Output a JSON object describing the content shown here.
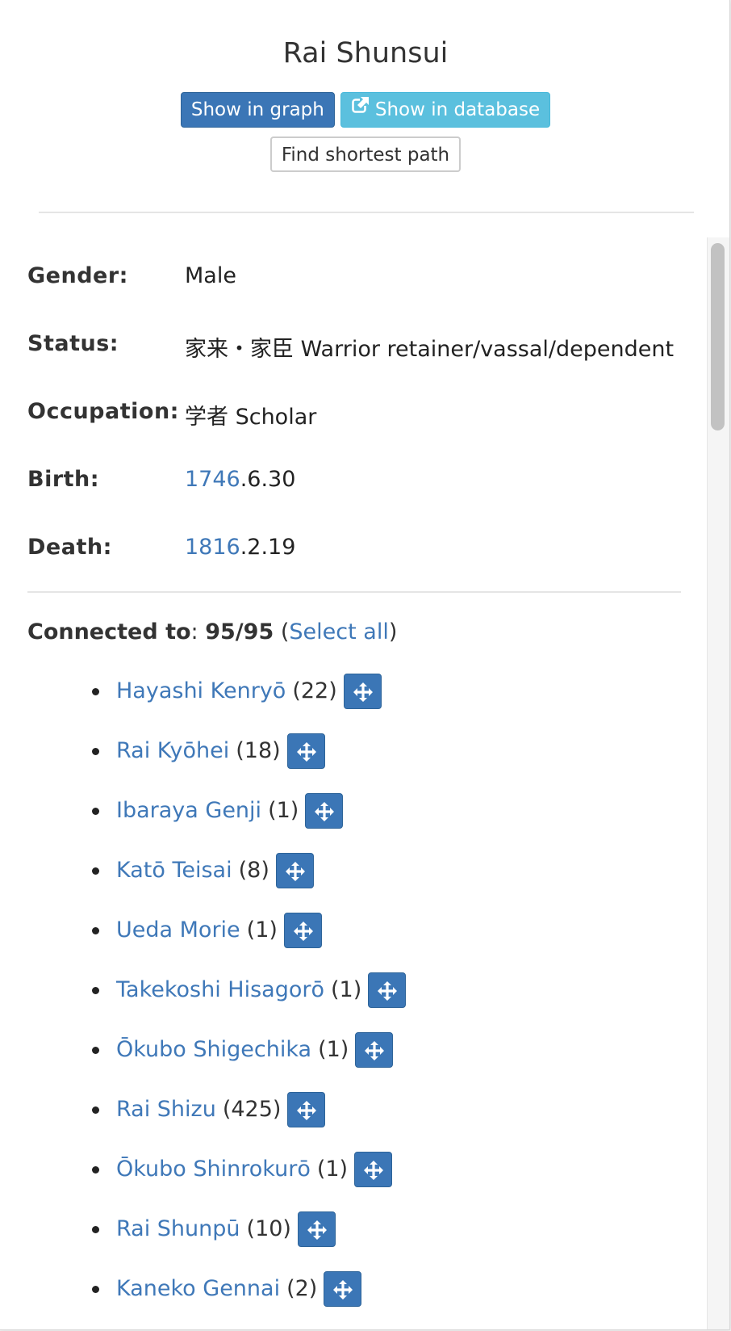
{
  "header": {
    "title": "Rai Shunsui",
    "show_in_graph_label": "Show in graph",
    "show_in_database_label": "Show in database",
    "find_shortest_path_label": "Find shortest path"
  },
  "fields": {
    "gender": {
      "label": "Gender:",
      "value": "Male"
    },
    "status": {
      "label": "Status:",
      "value": "家来・家臣 Warrior retainer/vassal/dependent"
    },
    "occupation": {
      "label": "Occupation:",
      "value": "学者 Scholar"
    },
    "birth": {
      "label": "Birth:",
      "year": "1746",
      "rest": ".6.30"
    },
    "death": {
      "label": "Death:",
      "year": "1816",
      "rest": ".2.19"
    }
  },
  "connections": {
    "label": "Connected to",
    "separator": ":",
    "count": "95/95",
    "select_all_open": "(",
    "select_all_label": "Select all",
    "select_all_close": ")",
    "items": [
      {
        "name": "Hayashi Kenryō",
        "count": "(22)"
      },
      {
        "name": "Rai Kyōhei",
        "count": "(18)"
      },
      {
        "name": "Ibaraya Genji",
        "count": "(1)"
      },
      {
        "name": "Katō Teisai",
        "count": "(8)"
      },
      {
        "name": "Ueda Morie",
        "count": "(1)"
      },
      {
        "name": "Takekoshi Hisagorō",
        "count": "(1)"
      },
      {
        "name": "Ōkubo Shigechika",
        "count": "(1)"
      },
      {
        "name": "Rai Shizu",
        "count": "(425)"
      },
      {
        "name": "Ōkubo Shinrokurō",
        "count": "(1)"
      },
      {
        "name": "Rai Shunpū",
        "count": "(10)"
      },
      {
        "name": "Kaneko Gennai",
        "count": "(2)"
      }
    ]
  },
  "icons": {
    "external_link": "external-link-icon",
    "move": "move-arrows-icon"
  },
  "colors": {
    "primary": "#3b76b6",
    "info": "#5bc0de",
    "link": "#3f78b8"
  }
}
